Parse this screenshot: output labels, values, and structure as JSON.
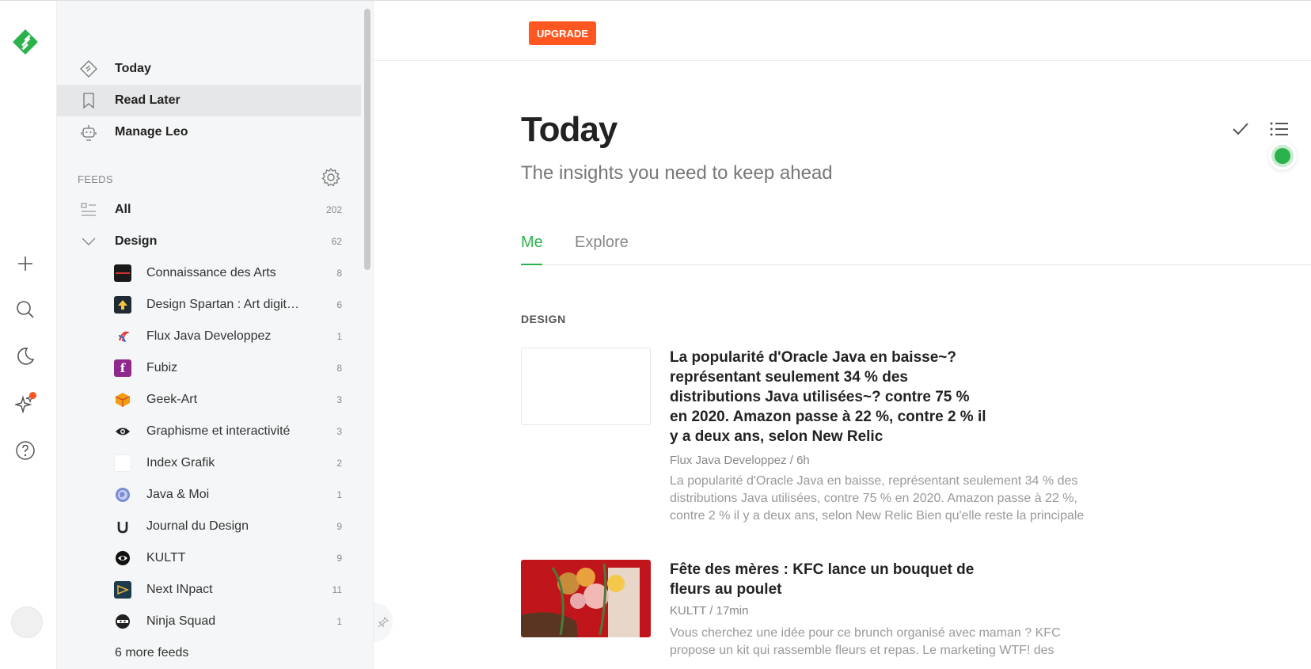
{
  "rail": {
    "logo": "feedly-logo",
    "buttons": [
      "add-icon",
      "search-icon",
      "moon-icon",
      "sparkle-icon",
      "help-icon"
    ]
  },
  "sidebar": {
    "nav": [
      {
        "label": "Today",
        "icon": "today-icon"
      },
      {
        "label": "Read Later",
        "icon": "bookmark-icon"
      },
      {
        "label": "Manage Leo",
        "icon": "robot-icon"
      }
    ],
    "feeds_header": "FEEDS",
    "all": {
      "label": "All",
      "count": "202"
    },
    "design": {
      "label": "Design",
      "count": "62"
    },
    "subfeeds": [
      {
        "label": "Connaissance des Arts",
        "count": "8"
      },
      {
        "label": "Design Spartan : Art digital & Design",
        "count": "6"
      },
      {
        "label": "Flux Java Developpez",
        "count": "1"
      },
      {
        "label": "Fubiz",
        "count": "8"
      },
      {
        "label": "Geek-Art",
        "count": "3"
      },
      {
        "label": "Graphisme et interactivité",
        "count": "3"
      },
      {
        "label": "Index Grafik",
        "count": "2"
      },
      {
        "label": "Java & Moi",
        "count": "1"
      },
      {
        "label": "Journal du Design",
        "count": "9"
      },
      {
        "label": "KULTT",
        "count": "9"
      },
      {
        "label": "Next INpact",
        "count": "11"
      },
      {
        "label": "Ninja Squad",
        "count": "1"
      }
    ],
    "more_feeds": "6 more feeds"
  },
  "main": {
    "upgrade_label": "UPGRADE",
    "title": "Today",
    "subtitle": "The insights you need to keep ahead",
    "tabs": [
      {
        "label": "Me"
      },
      {
        "label": "Explore"
      }
    ],
    "section": "DESIGN",
    "articles": [
      {
        "title": "La popularité d'Oracle Java en baisse~? représentant seulement 34 % des distributions Java utilisées~? contre 75 % en 2020. Amazon passe à 22 %, contre 2 % il y a deux ans, selon New Relic",
        "meta": "Flux Java Developpez / 6h",
        "summary": "La popularité d'Oracle Java en baisse, représentant seulement 34 % des distributions Java utilisées, contre 75 % en 2020. Amazon passe à 22 %, contre 2 % il y a deux ans, selon New Relic Bien qu'elle reste la principale"
      },
      {
        "title": "Fête des mères : KFC lance un bouquet de fleurs au poulet",
        "meta": "KULTT / 17min",
        "summary": "Vous cherchez une idée pour ce brunch organisé avec maman ? KFC propose un kit qui rassemble fleurs et repas. Le marketing WTF! des"
      }
    ]
  },
  "colors": {
    "accent": "#2bb24c",
    "upgrade": "#ff5722"
  }
}
